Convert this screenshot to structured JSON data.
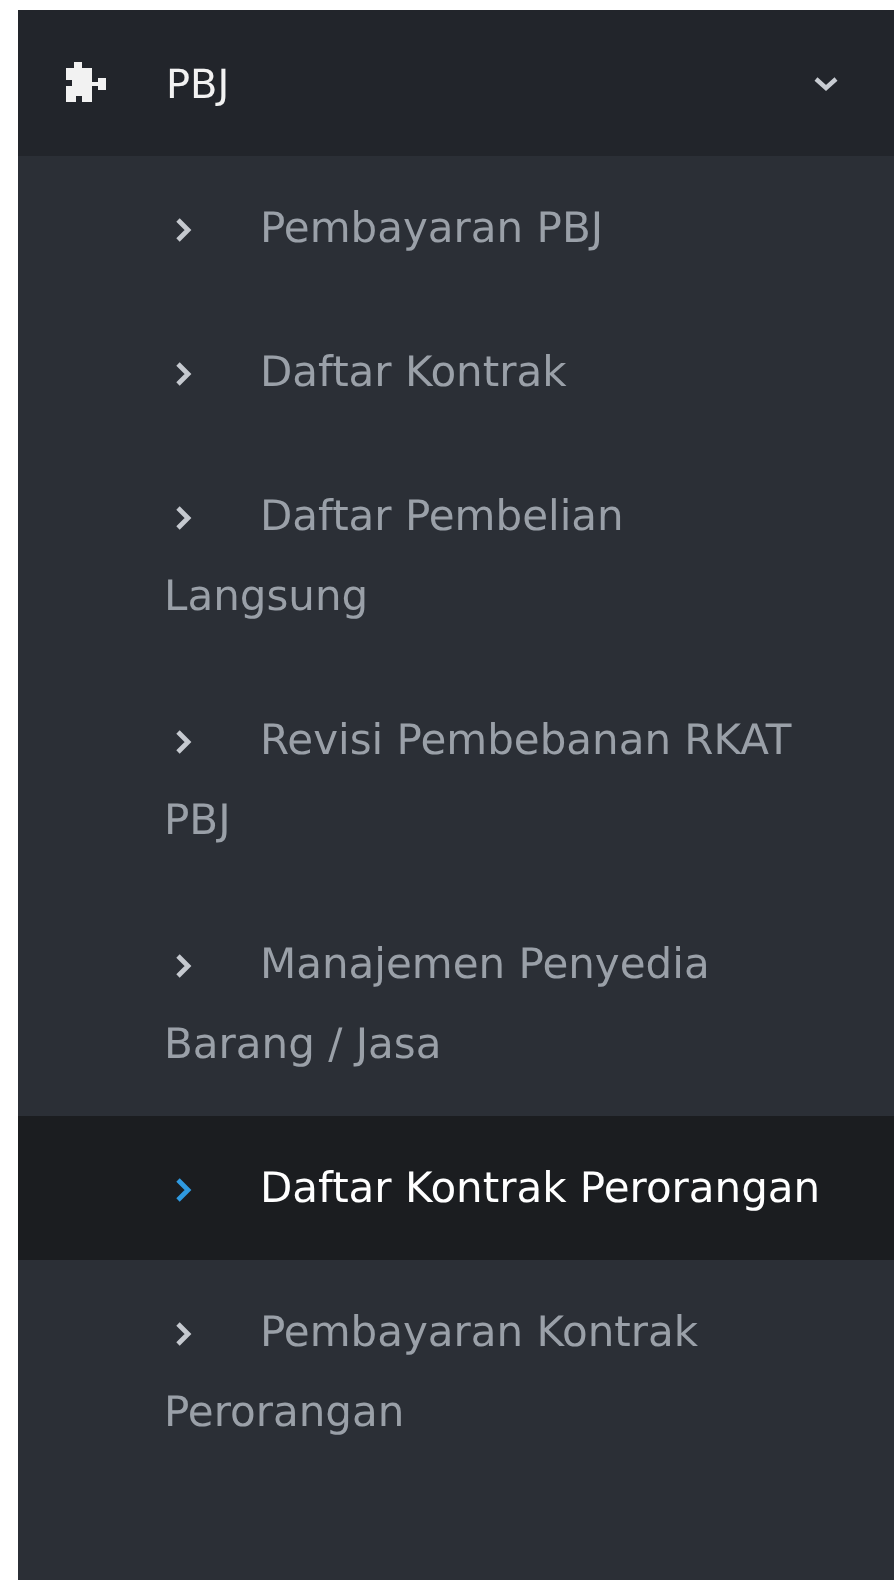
{
  "menu": {
    "title": "PBJ",
    "expanded": true,
    "items": [
      {
        "label": "Pembayaran PBJ",
        "selected": false
      },
      {
        "label": "Daftar Kontrak",
        "selected": false
      },
      {
        "label": "Daftar Pembelian Langsung",
        "selected": false
      },
      {
        "label": "Revisi Pembebanan RKAT PBJ",
        "selected": false
      },
      {
        "label": "Manajemen Penyedia Barang / Jasa",
        "selected": false
      },
      {
        "label": "Daftar Kontrak Perorangan",
        "selected": true
      },
      {
        "label": "Pembayaran Kontrak Perorangan",
        "selected": false
      }
    ]
  }
}
